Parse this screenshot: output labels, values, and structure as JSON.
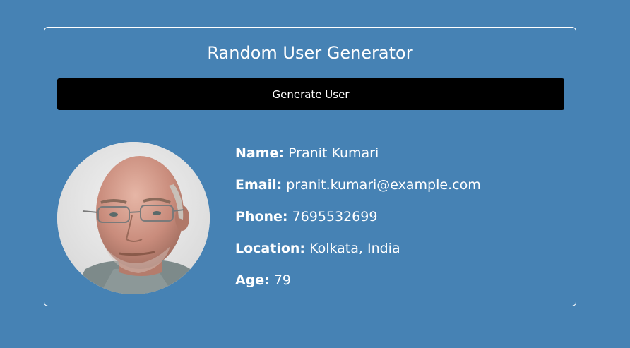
{
  "header": {
    "title": "Random User Generator"
  },
  "actions": {
    "generate_label": "Generate User"
  },
  "user": {
    "name_label": "Name:",
    "name": "Pranit Kumari",
    "email_label": "Email:",
    "email": "pranit.kumari@example.com",
    "phone_label": "Phone:",
    "phone": "7695532699",
    "location_label": "Location:",
    "location": "Kolkata, India",
    "age_label": "Age:",
    "age": "79"
  },
  "colors": {
    "background": "#4682b4",
    "card_border": "#ffffff",
    "button_bg": "#000000",
    "text": "#ffffff"
  },
  "icons": {
    "avatar": "user-photo"
  }
}
